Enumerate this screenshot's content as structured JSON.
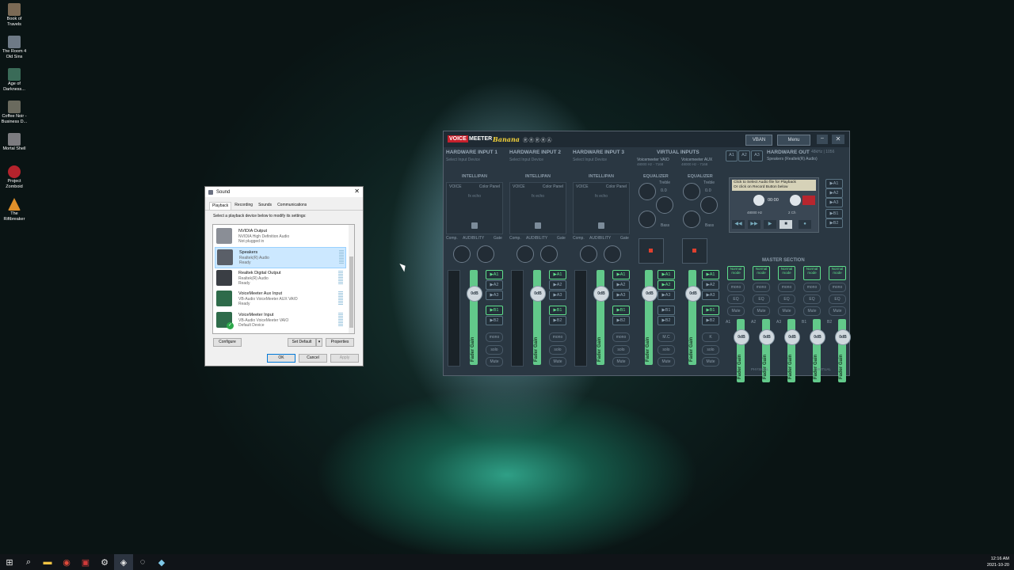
{
  "desktop": {
    "icons": [
      {
        "label": "Book of Travels",
        "icon": "book-of-travels-icon",
        "color": "#7b6a55"
      },
      {
        "label": "The Room 4 Old Sins",
        "icon": "room4-icon",
        "color": "#6e7a86"
      },
      {
        "label": "Age of Darkness...",
        "icon": "age-of-darkness-icon",
        "color": "#3a6b58"
      },
      {
        "label": "Coffee Noir - Business D...",
        "icon": "coffee-noir-icon",
        "color": "#6a6a5e"
      },
      {
        "label": "Mortal Shell",
        "icon": "mortal-shell-icon",
        "color": "#7c7c80"
      },
      {
        "label": "Project Zomboid",
        "icon": "project-zomboid-icon",
        "color": "#b5232c"
      },
      {
        "label": "The Riftbreaker",
        "icon": "riftbreaker-icon",
        "color": "#e0902a"
      }
    ]
  },
  "taskbar": {
    "buttons": [
      {
        "name": "start",
        "glyph": "⊞"
      },
      {
        "name": "search",
        "glyph": "⌕"
      },
      {
        "name": "file-explorer",
        "glyph": "▬"
      },
      {
        "name": "chrome",
        "glyph": "◉"
      },
      {
        "name": "voicemeeter-task",
        "glyph": "▣"
      },
      {
        "name": "settings",
        "glyph": "⚙"
      },
      {
        "name": "app-active",
        "glyph": "◈"
      },
      {
        "name": "clock-app",
        "glyph": "◌"
      },
      {
        "name": "app-other",
        "glyph": "◆"
      }
    ],
    "time": "12:16 AM",
    "date": "2021-10-20"
  },
  "sound_dialog": {
    "title": "Sound",
    "tabs": [
      "Playback",
      "Recording",
      "Sounds",
      "Communications"
    ],
    "selected_tab": "Playback",
    "hint": "Select a playback device below to modify its settings:",
    "devices": [
      {
        "name": "NVIDIA Output",
        "driver": "NVIDIA High Definition Audio",
        "status": "Not plugged in",
        "icon": "monitor-icon"
      },
      {
        "name": "Speakers",
        "driver": "Realtek(R) Audio",
        "status": "Ready",
        "icon": "speaker-icon",
        "selected": true
      },
      {
        "name": "Realtek Digital Output",
        "driver": "Realtek(R) Audio",
        "status": "Ready",
        "icon": "digital-output-icon"
      },
      {
        "name": "VoiceMeeter Aux Input",
        "driver": "VB-Audio VoiceMeeter AUX VAIO",
        "status": "Ready",
        "icon": "voicemeeter-aux-icon"
      },
      {
        "name": "VoiceMeeter Input",
        "driver": "VB-Audio VoiceMeeter VAIO",
        "status": "Default Device",
        "icon": "voicemeeter-input-icon"
      }
    ],
    "buttons": {
      "configure": "Configure",
      "set_default": "Set Default",
      "properties": "Properties",
      "ok": "OK",
      "cancel": "Cancel",
      "apply": "Apply"
    }
  },
  "voicemeeter": {
    "logo": {
      "voice": "VOICE",
      "meeter": "MEETER",
      "edition": "Banana",
      "r": "ⓇⓇⓇⓇⒶ"
    },
    "vban": "VBAN",
    "menu": "Menu",
    "hw_inputs": [
      {
        "title": "HARDWARE INPUT 1",
        "sub": "Select Input Device"
      },
      {
        "title": "HARDWARE INPUT 2",
        "sub": "Select Input Device"
      },
      {
        "title": "HARDWARE INPUT 3",
        "sub": "Select Input Device"
      }
    ],
    "virtual": {
      "title": "VIRTUAL INPUTS",
      "inputs": [
        {
          "name": "Voicemeeter VAIO",
          "rate": "48000 Hz - 7168"
        },
        {
          "name": "Voicemeeter AUX",
          "rate": "48000 Hz - 7168"
        }
      ],
      "equalizer": "EQUALIZER",
      "treble": "Treble",
      "bass": "Bass",
      "eq_value": "0.0"
    },
    "strip_text": {
      "intellipan": "INTELLIPAN",
      "voice": "VOICE",
      "color_panel": "Color Panel",
      "fx_echo": "fx echo",
      "brightness": "brightness",
      "comp": "Comp.",
      "audibility": "AUDIBILITY",
      "gate": "Gate",
      "fader_gain": "Fader Gain",
      "db": "0dB",
      "a1": "▶A1",
      "a2": "▶A2",
      "a3": "▶A3",
      "b1": "▶B1",
      "b2": "▶B2",
      "mono": "mono",
      "solo": "solo",
      "mute": "Mute",
      "mc": "M.C",
      "k": "K"
    },
    "hw_out": {
      "label": "HARDWARE OUT",
      "rate": "48kHz | 1056",
      "device": "Speakers (Realtek(R) Audio)",
      "a_buttons": [
        "A1",
        "A2",
        "A3"
      ]
    },
    "player": {
      "tip1": "Click to Select Audio file for Playback",
      "tip2": "Or click on Record Button below",
      "time": "00:00",
      "hz": "48000 Hz",
      "ch": "2 Ch"
    },
    "master": {
      "title": "MASTER SECTION",
      "mode": "Normal mode",
      "bus_names": [
        "A1",
        "A2",
        "A3",
        "B1",
        "B2"
      ],
      "physical": "PHYSICAL",
      "virtual": "VIRTUAL"
    }
  }
}
